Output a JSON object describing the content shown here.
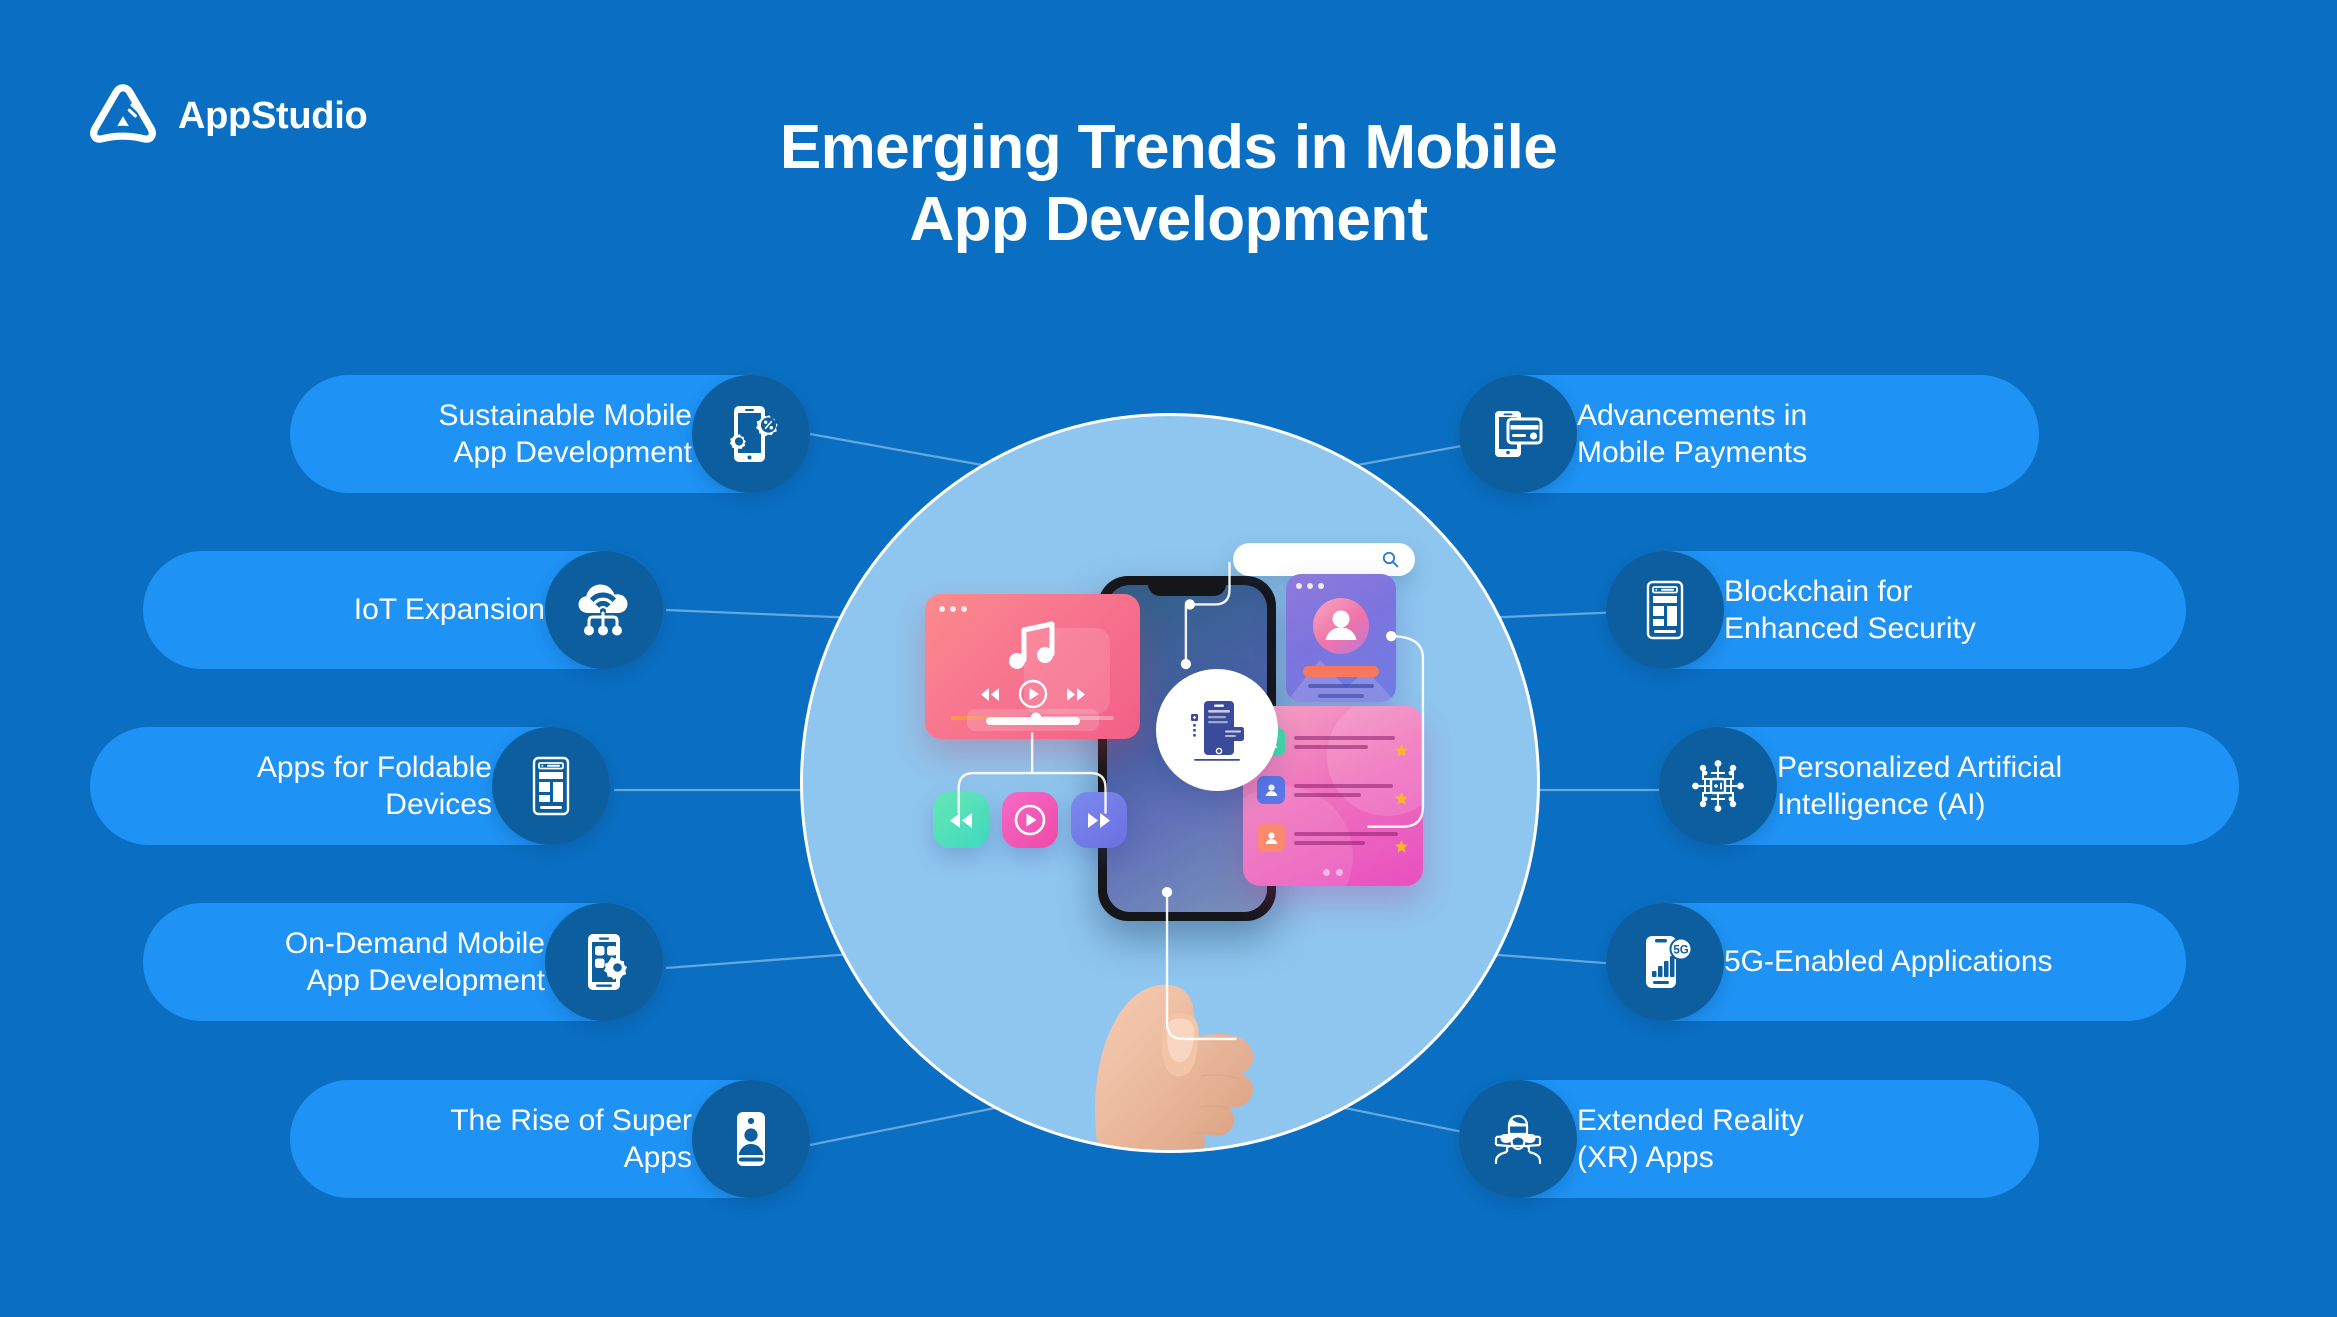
{
  "brand": {
    "name": "AppStudio",
    "logo_icon": "appstudio-triangle-logo"
  },
  "header": {
    "title_line1": "Emerging Trends in Mobile",
    "title_line2": "App Development"
  },
  "colors": {
    "background": "#0a6fc2",
    "pill": "#1e93f5",
    "icon_circle": "#0c5e9f",
    "hub_circle": "#8fc6ef",
    "text": "#ffffff"
  },
  "trends_left": [
    {
      "label": "Sustainable Mobile\nApp Development",
      "icon": "phone-gear-percent-icon"
    },
    {
      "label": "IoT Expansion",
      "icon": "cloud-wifi-nodes-icon"
    },
    {
      "label": "Apps for Foldable\nDevices",
      "icon": "foldable-split-screen-phone-icon"
    },
    {
      "label": "On-Demand Mobile\nApp Development",
      "icon": "phone-app-grid-gear-icon"
    },
    {
      "label": "The Rise of Super\nApps",
      "icon": "phone-user-profile-icon"
    }
  ],
  "trends_right": [
    {
      "label": "Advancements in\nMobile Payments",
      "icon": "phone-credit-card-icon"
    },
    {
      "label": "Blockchain for\nEnhanced Security",
      "icon": "phone-layout-blocks-icon"
    },
    {
      "label": "Personalized Artificial\nIntelligence (AI)",
      "icon": "ai-chip-network-icon"
    },
    {
      "label": "5G-Enabled Applications",
      "icon": "phone-signal-5g-icon"
    },
    {
      "label": "Extended Reality\n(XR) Apps",
      "icon": "vr-headset-person-icon"
    }
  ],
  "illustration": {
    "hand_phone": "hand-holding-smartphone",
    "music_card": {
      "icon": "music-note-icon",
      "controls": [
        "rewind-icon",
        "play-icon",
        "forward-icon"
      ],
      "progress_percent": 52
    },
    "media_buttons": [
      {
        "icon": "rewind-icon",
        "color": "#45dcae"
      },
      {
        "icon": "play-icon",
        "color": "#ef49a8"
      },
      {
        "icon": "forward-icon",
        "color": "#6b6fe0"
      }
    ],
    "search_bar": {
      "icon": "search-icon",
      "value": ""
    },
    "profile_card": {
      "icon": "user-avatar-icon"
    },
    "contact_list_card": {
      "rows": [
        {
          "avatar": "user-icon",
          "color": "#45dcae",
          "star": "star-icon"
        },
        {
          "avatar": "user-icon",
          "color": "#5b77e8",
          "star": "star-icon"
        },
        {
          "avatar": "user-icon",
          "color": "#fa8a6e",
          "star": "star-icon"
        }
      ]
    },
    "center_bubble": {
      "icon": "mobile-app-development-icon"
    }
  }
}
